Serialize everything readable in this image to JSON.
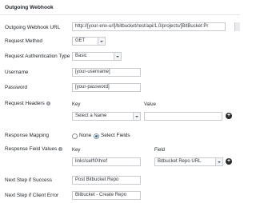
{
  "section": {
    "title": "Outgoing Webhook"
  },
  "fields": {
    "url": {
      "label": "Outgoing Webhook URL",
      "value": "http://[your-env-url]/bitbucket/rest/api/1.0/projects/[BitBucket Pr"
    },
    "method": {
      "label": "Request Method",
      "value": "GET"
    },
    "auth_type": {
      "label": "Request Authentication Type",
      "value": "Basic"
    },
    "username": {
      "label": "Username",
      "value": "[your-username]"
    },
    "password": {
      "label": "Password",
      "value": "[your-password]"
    },
    "headers": {
      "label": "Request Headers",
      "key_header": "Key",
      "value_header": "Value",
      "key_select": "Select a Name",
      "value_input": ""
    },
    "response_mapping": {
      "label": "Response Mapping",
      "options": [
        "None",
        "Select Fields"
      ],
      "selected": "Select Fields"
    },
    "response_field_values": {
      "label": "Response Field Values",
      "key_header": "Key",
      "field_header": "Field",
      "key_value": "links\\self\\0\\href",
      "field_value": "Bitbucket Repo URL"
    },
    "next_success": {
      "label": "Next Step if Success",
      "value": "Post Bitbucket Repo"
    },
    "next_client_error": {
      "label": "Next Step if Client Error",
      "value": "Bitbucket - Create Repo"
    }
  },
  "icons": {
    "add": "plus-circle-icon",
    "help": "question-circle-icon",
    "dropdown": "chevron-down-icon"
  },
  "colors": {
    "accent": "#2271b1",
    "border": "#c8ccd0",
    "text": "#23282d"
  }
}
